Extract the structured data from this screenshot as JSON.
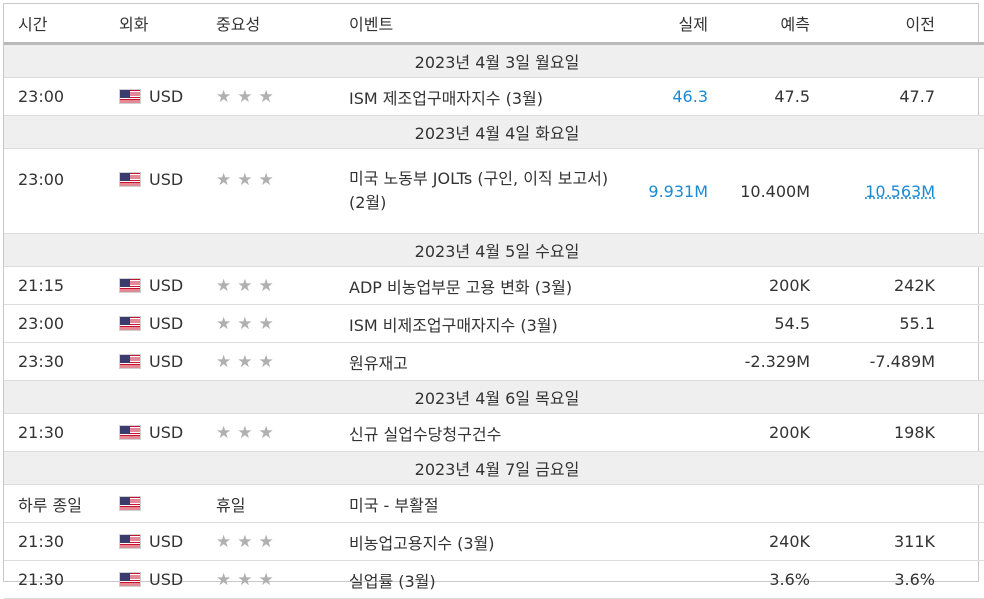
{
  "header": {
    "time": "시간",
    "currency": "외화",
    "importance": "중요성",
    "event": "이벤트",
    "actual": "실제",
    "forecast": "예측",
    "previous": "이전"
  },
  "days": [
    {
      "label": "2023년 4월 3일 월요일",
      "events": [
        {
          "time": "23:00",
          "currency": "USD",
          "stars": "★★★",
          "event": "ISM 제조업구매자지수 (3월)",
          "actual": "46.3",
          "forecast": "47.5",
          "previous": "47.7"
        }
      ]
    },
    {
      "label": "2023년 4월 4일 화요일",
      "events": [
        {
          "time": "23:00",
          "currency": "USD",
          "stars": "★★★",
          "event": "미국 노동부 JOLTs (구인, 이직 보고서) (2월)",
          "actual": "9.931M",
          "forecast": "10.400M",
          "previous": "10.563M"
        }
      ]
    },
    {
      "label": "2023년 4월 5일 수요일",
      "events": [
        {
          "time": "21:15",
          "currency": "USD",
          "stars": "★★★",
          "event": "ADP 비농업부문 고용 변화 (3월)",
          "actual": "",
          "forecast": "200K",
          "previous": "242K"
        },
        {
          "time": "23:00",
          "currency": "USD",
          "stars": "★★★",
          "event": "ISM 비제조업구매자지수 (3월)",
          "actual": "",
          "forecast": "54.5",
          "previous": "55.1"
        },
        {
          "time": "23:30",
          "currency": "USD",
          "stars": "★★★",
          "event": "원유재고",
          "actual": "",
          "forecast": "-2.329M",
          "previous": "-7.489M"
        }
      ]
    },
    {
      "label": "2023년 4월 6일 목요일",
      "events": [
        {
          "time": "21:30",
          "currency": "USD",
          "stars": "★★★",
          "event": "신규 실업수당청구건수",
          "actual": "",
          "forecast": "200K",
          "previous": "198K"
        }
      ]
    },
    {
      "label": "2023년 4월 7일 금요일",
      "events": [
        {
          "time": "하루 종일",
          "currency": "",
          "importance_text": "휴일",
          "event": "미국 - 부활절"
        },
        {
          "time": "21:30",
          "currency": "USD",
          "stars": "★★★",
          "event": "비농업고용지수 (3월)",
          "actual": "",
          "forecast": "240K",
          "previous": "311K"
        },
        {
          "time": "21:30",
          "currency": "USD",
          "stars": "★★★",
          "event": "실업률 (3월)",
          "actual": "",
          "forecast": "3.6%",
          "previous": "3.6%"
        }
      ]
    }
  ],
  "colors": {
    "actual_positive": "#1a8ad4",
    "day_row_bg": "#efefef",
    "star": "#b0b0b0"
  },
  "icons": {
    "flag": "us-flag-icon",
    "importance": "star-icon"
  }
}
